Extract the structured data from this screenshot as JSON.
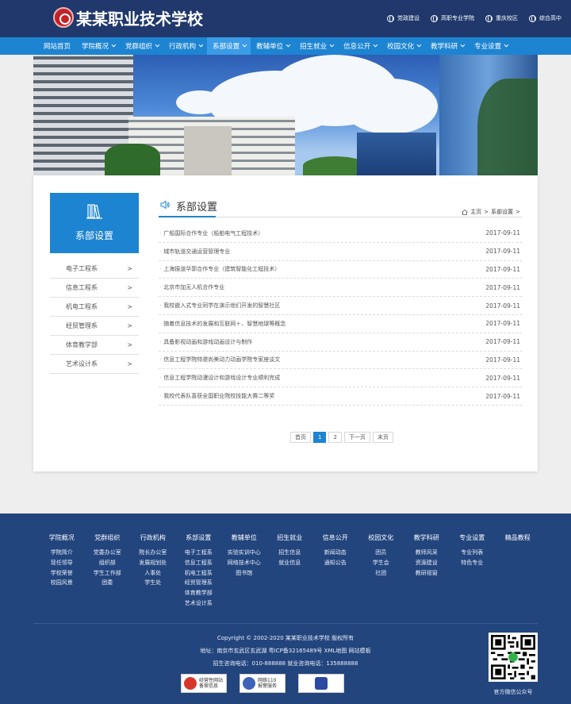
{
  "header": {
    "site_title": "某某职业技术学校",
    "top_links": [
      "党政建设",
      "高职专业学院",
      "重庆校区",
      "综合高中"
    ]
  },
  "nav": {
    "items": [
      {
        "label": "网站首页",
        "dropdown": false
      },
      {
        "label": "学院概况",
        "dropdown": true
      },
      {
        "label": "党群组织",
        "dropdown": true
      },
      {
        "label": "行政机构",
        "dropdown": true
      },
      {
        "label": "系部设置",
        "dropdown": true,
        "active": true
      },
      {
        "label": "教辅单位",
        "dropdown": true
      },
      {
        "label": "招生就业",
        "dropdown": true
      },
      {
        "label": "信息公开",
        "dropdown": true
      },
      {
        "label": "校园文化",
        "dropdown": true
      },
      {
        "label": "教学科研",
        "dropdown": true
      },
      {
        "label": "专业设置",
        "dropdown": true
      }
    ]
  },
  "sidebar": {
    "title": "系部设置",
    "items": [
      "电子工程系",
      "信息工程系",
      "机电工程系",
      "经贸管理系",
      "体育教学部",
      "艺术设计系"
    ],
    "arrow": ">"
  },
  "content": {
    "title": "系部设置",
    "breadcrumb": {
      "home": "主页",
      "sep": ">",
      "current": "系部设置",
      "tail": ">"
    },
    "articles": [
      {
        "title": "广船国际合作专业（船舶电气工程技术）",
        "date": "2017-09-11"
      },
      {
        "title": "城市轨道交通运营管理专业",
        "date": "2017-09-11"
      },
      {
        "title": "上海振道华郭合作专业（建筑智能化工程技术）",
        "date": "2017-09-11"
      },
      {
        "title": "北京市加无人机合作专业",
        "date": "2017-09-11"
      },
      {
        "title": "我校嵌入式专业同学在演示他们开发的智慧社区",
        "date": "2017-09-11"
      },
      {
        "title": "随着信息技术的发展和互联网＋、智慧地球等概念",
        "date": "2017-09-11"
      },
      {
        "title": "具备影视动画和游戏动画设计与制作",
        "date": "2017-09-11"
      },
      {
        "title": "信息工程学院特邀尚美动力动画学院专家座谈文",
        "date": "2017-09-11"
      },
      {
        "title": "信息工程学院动漫设计和游戏设计专业顺利完成",
        "date": "2017-09-11"
      },
      {
        "title": "我校代表队喜获全国职业院校技能大赛二等奖",
        "date": "2017-09-11"
      }
    ]
  },
  "pager": {
    "first": "首页",
    "pages": [
      "1",
      "2"
    ],
    "current": "1",
    "next": "下一页",
    "last": "末页"
  },
  "footer": {
    "columns": [
      {
        "head": "学院概况",
        "items": [
          "学院简介",
          "现任领导",
          "学校荣誉",
          "校园风景"
        ]
      },
      {
        "head": "党群组织",
        "items": [
          "党委办公室",
          "组织部",
          "学生工作部",
          "团委"
        ]
      },
      {
        "head": "行政机构",
        "items": [
          "院长办公室",
          "发展规划处",
          "人事处",
          "学生处"
        ]
      },
      {
        "head": "系部设置",
        "items": [
          "电子工程系",
          "信息工程系",
          "机电工程系",
          "经贸管理系",
          "体育教学部",
          "艺术设计系"
        ]
      },
      {
        "head": "教辅单位",
        "items": [
          "实验实训中心",
          "网络技术中心",
          "图书馆"
        ]
      },
      {
        "head": "招生就业",
        "items": [
          "招生信息",
          "就业信息"
        ]
      },
      {
        "head": "信息公开",
        "items": [
          "新闻动态",
          "通知公告"
        ]
      },
      {
        "head": "校园文化",
        "items": [
          "团员",
          "学生会",
          "社团"
        ]
      },
      {
        "head": "教学科研",
        "items": [
          "教师风采",
          "资源建设",
          "教研视窗"
        ]
      },
      {
        "head": "专业设置",
        "items": [
          "专业列表",
          "特色专业"
        ]
      },
      {
        "head": "精品教程",
        "items": []
      }
    ],
    "copyright": "Copyright © 2002-2020 某某职业技术学校 版权所有",
    "address": "地址：南京市玄武区玄武湖 粤ICP备32165489号 XML地图 网站模板",
    "phone": "招生咨询电话：010-888888 就业咨询电话：135888888",
    "badges": [
      {
        "line1": "经营性网站",
        "line2": "备案信息",
        "color": "#d9362b"
      },
      {
        "line1": "网络110",
        "line2": "报警服务",
        "color": "#3d63b8"
      },
      {
        "line1": "",
        "line2": "",
        "color": "#2c4aa0"
      }
    ],
    "qr_caption": "官方微信公众号"
  }
}
